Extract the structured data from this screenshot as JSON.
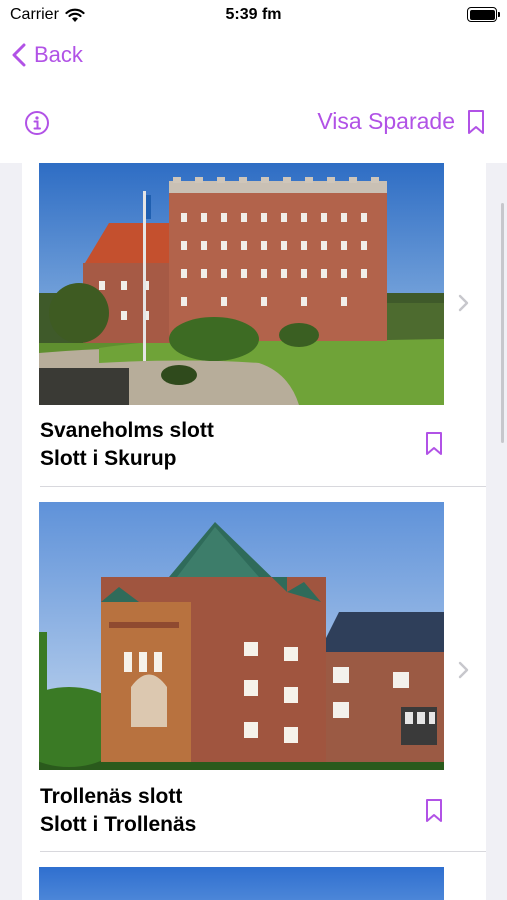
{
  "status": {
    "carrier": "Carrier",
    "time": "5:39 fm"
  },
  "nav": {
    "back_label": "Back"
  },
  "toolbar": {
    "saved_label": "Visa Sparade"
  },
  "colors": {
    "accent": "#b152e6",
    "background": "#f0f0f5"
  },
  "icons": {
    "back": "chevron-left-icon",
    "info": "info-circle-icon",
    "saved": "bookmark-icon",
    "wifi": "wifi-icon",
    "battery": "battery-icon",
    "row_chevron": "chevron-right-icon"
  },
  "items": [
    {
      "title": "Svaneholms slott",
      "subtitle": "Slott i Skurup"
    },
    {
      "title": "Trollenäs slott",
      "subtitle": "Slott i Trollenäs"
    }
  ]
}
